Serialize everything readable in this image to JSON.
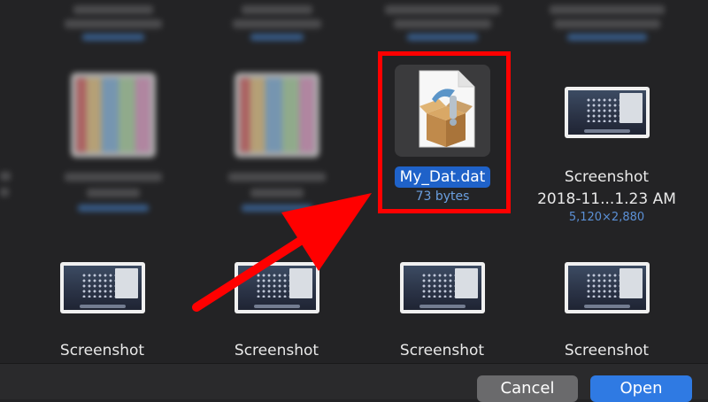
{
  "files": {
    "selected": {
      "name": "My_Dat.dat",
      "size": "73 bytes"
    },
    "screenshot_right": {
      "name": "Screenshot",
      "date": "2018-11...1.23 AM",
      "dimensions": "5,120×2,880"
    },
    "bottom_row": [
      {
        "name": "Screenshot"
      },
      {
        "name": "Screenshot"
      },
      {
        "name": "Screenshot"
      },
      {
        "name": "Screenshot"
      }
    ]
  },
  "buttons": {
    "cancel": "Cancel",
    "open": "Open"
  },
  "annotation": {
    "highlight_color": "#ff0000",
    "arrow_color": "#ff0000"
  },
  "icons": {
    "selected_file": "archive-box-icon"
  }
}
